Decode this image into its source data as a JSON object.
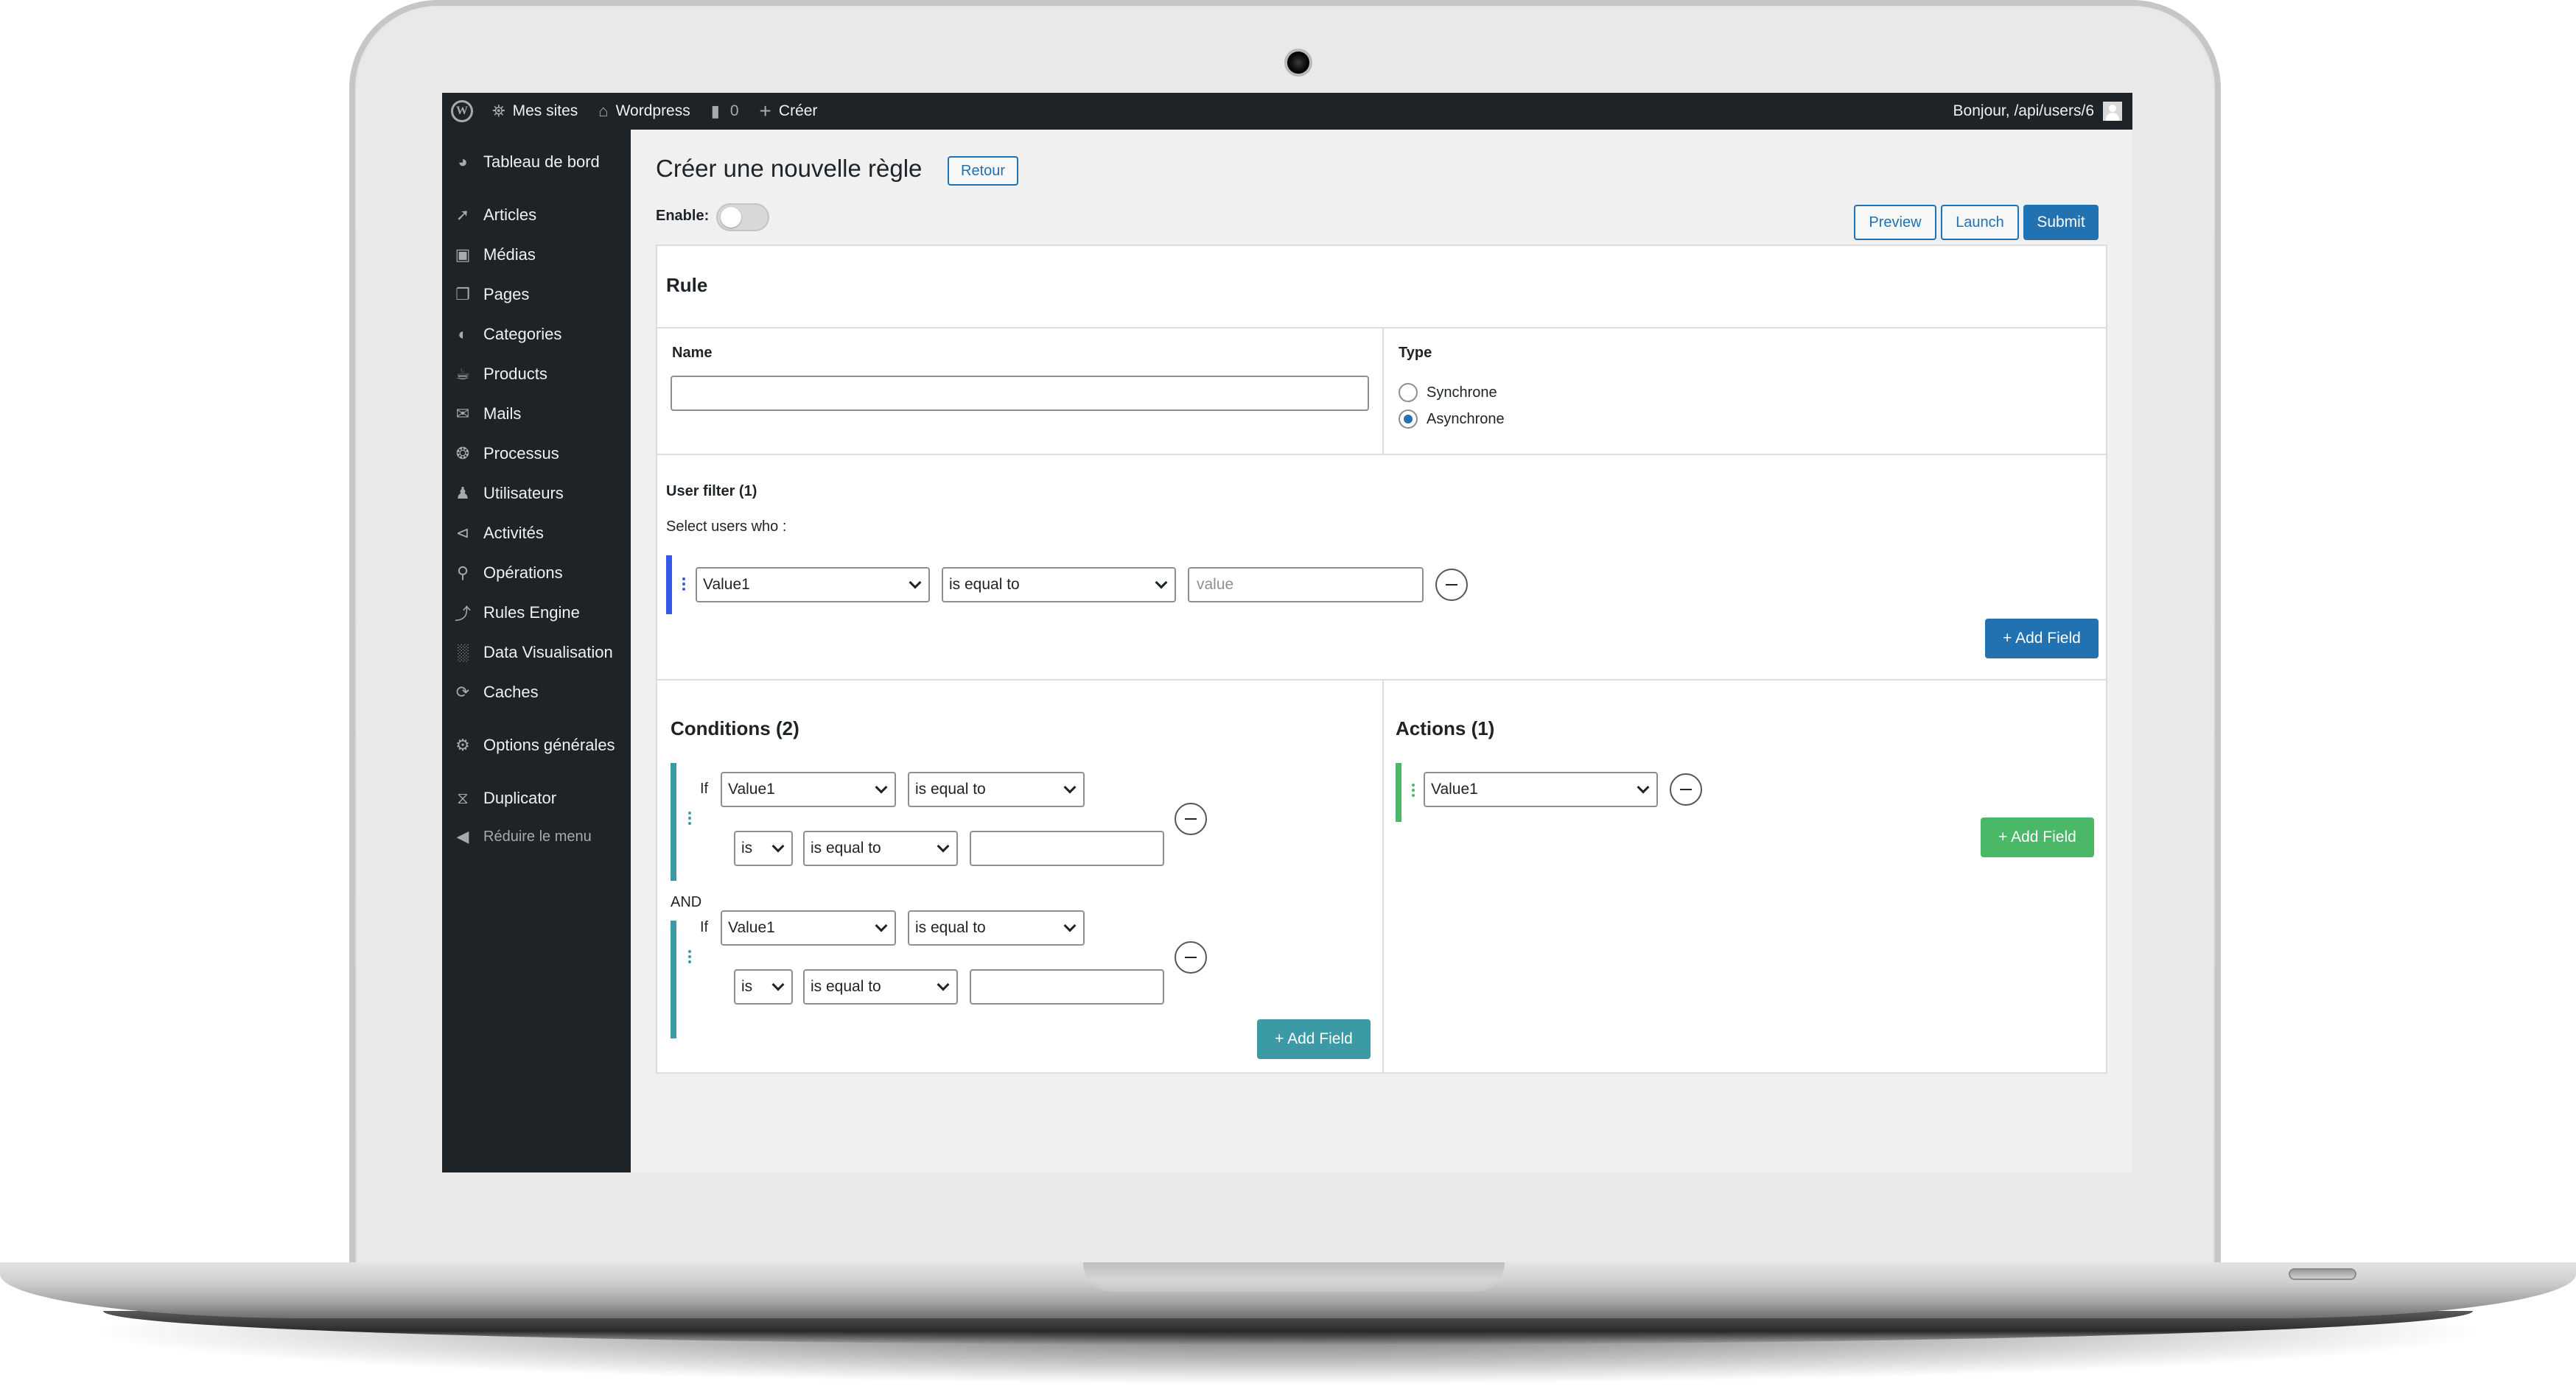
{
  "adminbar": {
    "my_sites": "Mes sites",
    "site_name": "Wordpress",
    "comments_count": "0",
    "new_label": "Créer",
    "greeting": "Bonjour, /api/users/6"
  },
  "sidebar": {
    "items": [
      {
        "label": "Tableau de bord",
        "icon": "dashboard-icon"
      },
      {
        "label": "Articles",
        "icon": "pin-icon"
      },
      {
        "label": "Médias",
        "icon": "media-icon"
      },
      {
        "label": "Pages",
        "icon": "pages-icon"
      },
      {
        "label": "Categories",
        "icon": "palette-icon"
      },
      {
        "label": "Products",
        "icon": "coffee-icon"
      },
      {
        "label": "Mails",
        "icon": "mail-icon"
      },
      {
        "label": "Processus",
        "icon": "process-icon"
      },
      {
        "label": "Utilisateurs",
        "icon": "user-icon"
      },
      {
        "label": "Activités",
        "icon": "share-icon"
      },
      {
        "label": "Opérations",
        "icon": "cart-icon"
      },
      {
        "label": "Rules Engine",
        "icon": "rules-icon"
      },
      {
        "label": "Data Visualisation",
        "icon": "chart-icon"
      },
      {
        "label": "Caches",
        "icon": "refresh-icon"
      },
      {
        "label": "Options générales",
        "icon": "gear-icon"
      },
      {
        "label": "Duplicator",
        "icon": "duplicator-icon"
      },
      {
        "label": "Réduire le menu",
        "icon": "collapse-icon"
      }
    ]
  },
  "page": {
    "title": "Créer une nouvelle règle",
    "back_label": "Retour",
    "enable_label": "Enable:",
    "preview_label": "Preview",
    "launch_label": "Launch",
    "submit_label": "Submit"
  },
  "rule": {
    "section_title": "Rule",
    "name_label": "Name",
    "name_value": "",
    "type_label": "Type",
    "type_options": [
      "Synchrone",
      "Asynchrone"
    ],
    "type_selected": "Asynchrone"
  },
  "user_filter": {
    "title": "User filter (1)",
    "subtitle": "Select users who :",
    "field": "Value1",
    "operator": "is equal to",
    "value_placeholder": "value",
    "add_label": "+ Add Field"
  },
  "conditions": {
    "title": "Conditions (2)",
    "joiner": "AND",
    "add_label": "+ Add Field",
    "items": [
      {
        "if_label": "If",
        "field": "Value1",
        "operator": "is equal to",
        "sub_is": "is",
        "sub_operator": "is equal to",
        "sub_value": ""
      },
      {
        "if_label": "If",
        "field": "Value1",
        "operator": "is equal to",
        "sub_is": "is",
        "sub_operator": "is equal to",
        "sub_value": ""
      }
    ]
  },
  "actions": {
    "title": "Actions (1)",
    "field": "Value1",
    "add_label": "+ Add Field"
  },
  "colors": {
    "admin_dark": "#1d2327",
    "primary_blue": "#2271b1",
    "filter_accent": "#3858e9",
    "conditions_teal": "#3c9aa6",
    "actions_green": "#4ab866"
  }
}
